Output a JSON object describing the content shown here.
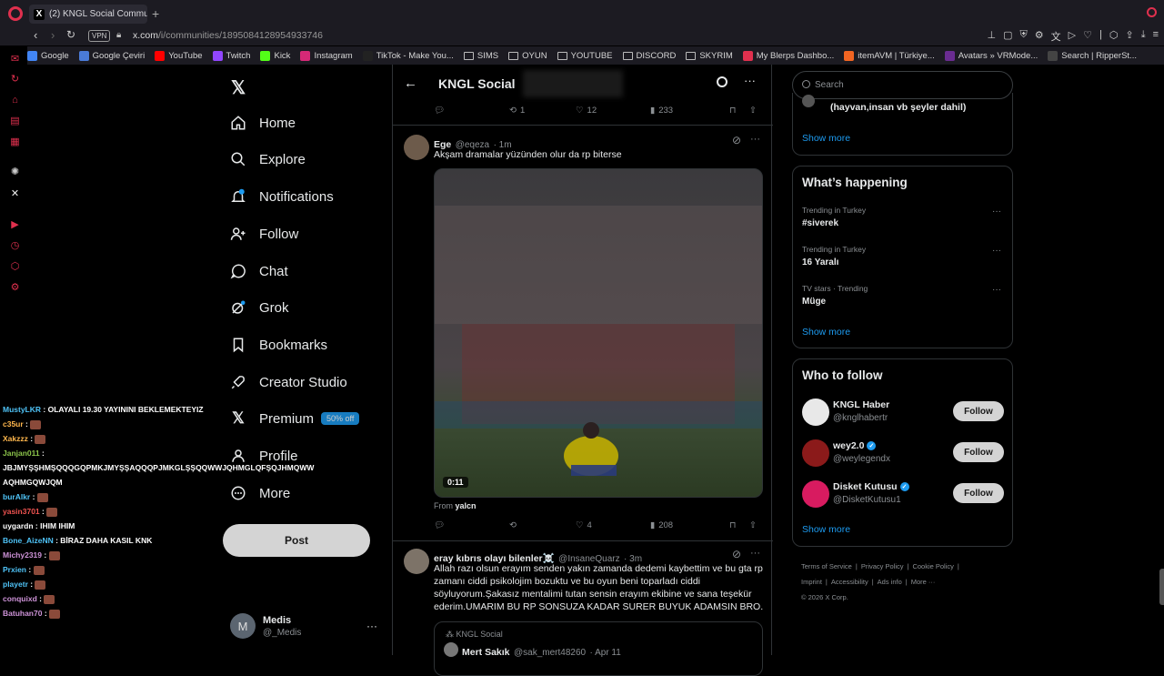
{
  "browser": {
    "tab_title": "(2) KNGL Social Communi",
    "url_host": "x.com",
    "url_path": "/i/communities/1895084128954933746",
    "vpn_label": "VPN",
    "bookmarks": [
      {
        "label": "Google",
        "icon": "google-icon",
        "color": "#4285f4"
      },
      {
        "label": "Google Çeviri",
        "icon": "translate-icon",
        "color": "#4a7bd8"
      },
      {
        "label": "YouTube",
        "icon": "youtube-icon",
        "color": "#ff0000"
      },
      {
        "label": "Twitch",
        "icon": "twitch-icon",
        "color": "#9146ff"
      },
      {
        "label": "Kick",
        "icon": "kick-icon",
        "color": "#53fc18"
      },
      {
        "label": "Instagram",
        "icon": "instagram-icon",
        "color": "#d62976"
      },
      {
        "label": "TikTok - Make You...",
        "icon": "tiktok-icon",
        "color": "#222222"
      },
      {
        "label": "SIMS",
        "icon": "folder-icon",
        "color": ""
      },
      {
        "label": "OYUN",
        "icon": "folder-icon",
        "color": ""
      },
      {
        "label": "YOUTUBE",
        "icon": "folder-icon",
        "color": ""
      },
      {
        "label": "DISCORD",
        "icon": "folder-icon",
        "color": ""
      },
      {
        "label": "SKYRIM",
        "icon": "folder-icon",
        "color": ""
      },
      {
        "label": "My Blerps Dashbo...",
        "icon": "blerp-icon",
        "color": "#e0304e"
      },
      {
        "label": "itemAVM | Türkiye...",
        "icon": "itemavm-icon",
        "color": "#f26522"
      },
      {
        "label": "Avatars » VRMode...",
        "icon": "vrmodels-icon",
        "color": "#6a2c91"
      },
      {
        "label": "Search | RipperSt...",
        "icon": "ripper-icon",
        "color": "#444444"
      }
    ]
  },
  "nav": {
    "home": "Home",
    "explore": "Explore",
    "notifications": "Notifications",
    "follow": "Follow",
    "chat": "Chat",
    "grok": "Grok",
    "bookmarks": "Bookmarks",
    "creator_studio": "Creator Studio",
    "premium": "Premium",
    "premium_badge": "50% off",
    "profile": "Profile",
    "more": "More",
    "post_button": "Post"
  },
  "account": {
    "avatar_letter": "M",
    "name": "Medis",
    "handle": "@_Medis"
  },
  "chat": [
    {
      "user": "MustyLKR",
      "text": "OLAYALI 19.30 YAYININI BEKLEMEKTEYIZ",
      "color": "#4fc3f7",
      "emote": false
    },
    {
      "user": "c35ur",
      "text": "",
      "color": "#ffb74d",
      "emote": true
    },
    {
      "user": "Xakzzz",
      "text": "",
      "color": "#ffb74d",
      "emote": true
    },
    {
      "user": "Janjan011",
      "text": "",
      "color": "#8bc34a",
      "emote": false
    },
    {
      "user": "",
      "text": "JBJMYŞŞHMŞQQQGQPMKJMYŞŞAQQQPJMKGLŞŞQQWWJQHMGLQFŞQJHMQWW",
      "color": "",
      "emote": false
    },
    {
      "user": "",
      "text": "AQHMGQWJQM",
      "color": "",
      "emote": false
    },
    {
      "user": "burAlkr",
      "text": "",
      "color": "#4fc3f7",
      "emote": true
    },
    {
      "user": "yasin3701",
      "text": "",
      "color": "#ef5350",
      "emote": true
    },
    {
      "user": "uygardn",
      "text": "IHIM IHIM",
      "color": "#ffffff",
      "emote": false
    },
    {
      "user": "Bone_AizeNN",
      "text": "BİRAZ DAHA KASIL KNK",
      "color": "#4fc3f7",
      "emote": false
    },
    {
      "user": "Michy2319",
      "text": "",
      "color": "#ce93d8",
      "emote": true
    },
    {
      "user": "Prxien",
      "text": "",
      "color": "#4fc3f7",
      "emote": true
    },
    {
      "user": "playetr",
      "text": "",
      "color": "#4fc3f7",
      "emote": true
    },
    {
      "user": "conquixd",
      "text": "",
      "color": "#ce93d8",
      "emote": true
    },
    {
      "user": "Batuhan70",
      "text": "",
      "color": "#ce93d8",
      "emote": true
    }
  ],
  "community": {
    "title": "KNGL Social"
  },
  "tweets": [
    {
      "prev_actions": {
        "retweets": "1",
        "likes": "12",
        "views": "233"
      }
    },
    {
      "name": "Ege",
      "handle": "@eqeza",
      "time": "· 1m",
      "text": "Akşam dramalar yüzünden olur da rp biterse",
      "video_time": "0:11",
      "from_label": "From",
      "from_user": "yalcn",
      "likes": "4",
      "views": "208"
    },
    {
      "name": "eray kıbrıs olayı bilenler☠️",
      "handle": "@InsaneQuarz",
      "time": "· 3m",
      "text": "Allah razı olsun erayım senden yakın zamanda dedemi kaybettim ve bu gta rp zamanı ciddi psikolojim bozuktu ve bu oyun beni toparladı ciddi söyluyorum.Şakasız mentalimi tutan sensin erayım ekibine ve sana teşekür ederim.UMARIM BU RP SONSUZA KADAR SURER BUYUK ADAMSIN BRO.",
      "quote_community": "KNGL Social",
      "quote_name": "Mert Sakık",
      "quote_handle": "@sak_mert48260",
      "quote_time": "· Apr 11"
    }
  ],
  "right": {
    "search_placeholder": "Search",
    "top_partial_text": "(hayvan,insan vb şeyler dahil)",
    "show_more": "Show more",
    "happening_title": "What’s happening",
    "trends": [
      {
        "meta": "Trending in Turkey",
        "name": "#siverek"
      },
      {
        "meta": "Trending in Turkey",
        "name": "16 Yaralı"
      },
      {
        "meta": "TV stars · Trending",
        "name": "Müge"
      }
    ],
    "wtf_title": "Who to follow",
    "wtf": [
      {
        "name": "KNGL Haber",
        "handle": "@knglhabertr",
        "verified": false,
        "color": "#e8e8e8"
      },
      {
        "name": "wey2.0",
        "handle": "@weylegendx",
        "verified": true,
        "color": "#8b1a1a"
      },
      {
        "name": "Disket Kutusu",
        "handle": "@DisketKutusu1",
        "verified": true,
        "color": "#d81b60"
      }
    ],
    "follow_label": "Follow",
    "footer": [
      "Terms of Service",
      "|",
      "Privacy Policy",
      "|",
      "Cookie Policy",
      "|",
      "Imprint",
      "|",
      "Accessibility",
      "|",
      "Ads info",
      "|",
      "More ···",
      "© 2026 X Corp."
    ]
  }
}
